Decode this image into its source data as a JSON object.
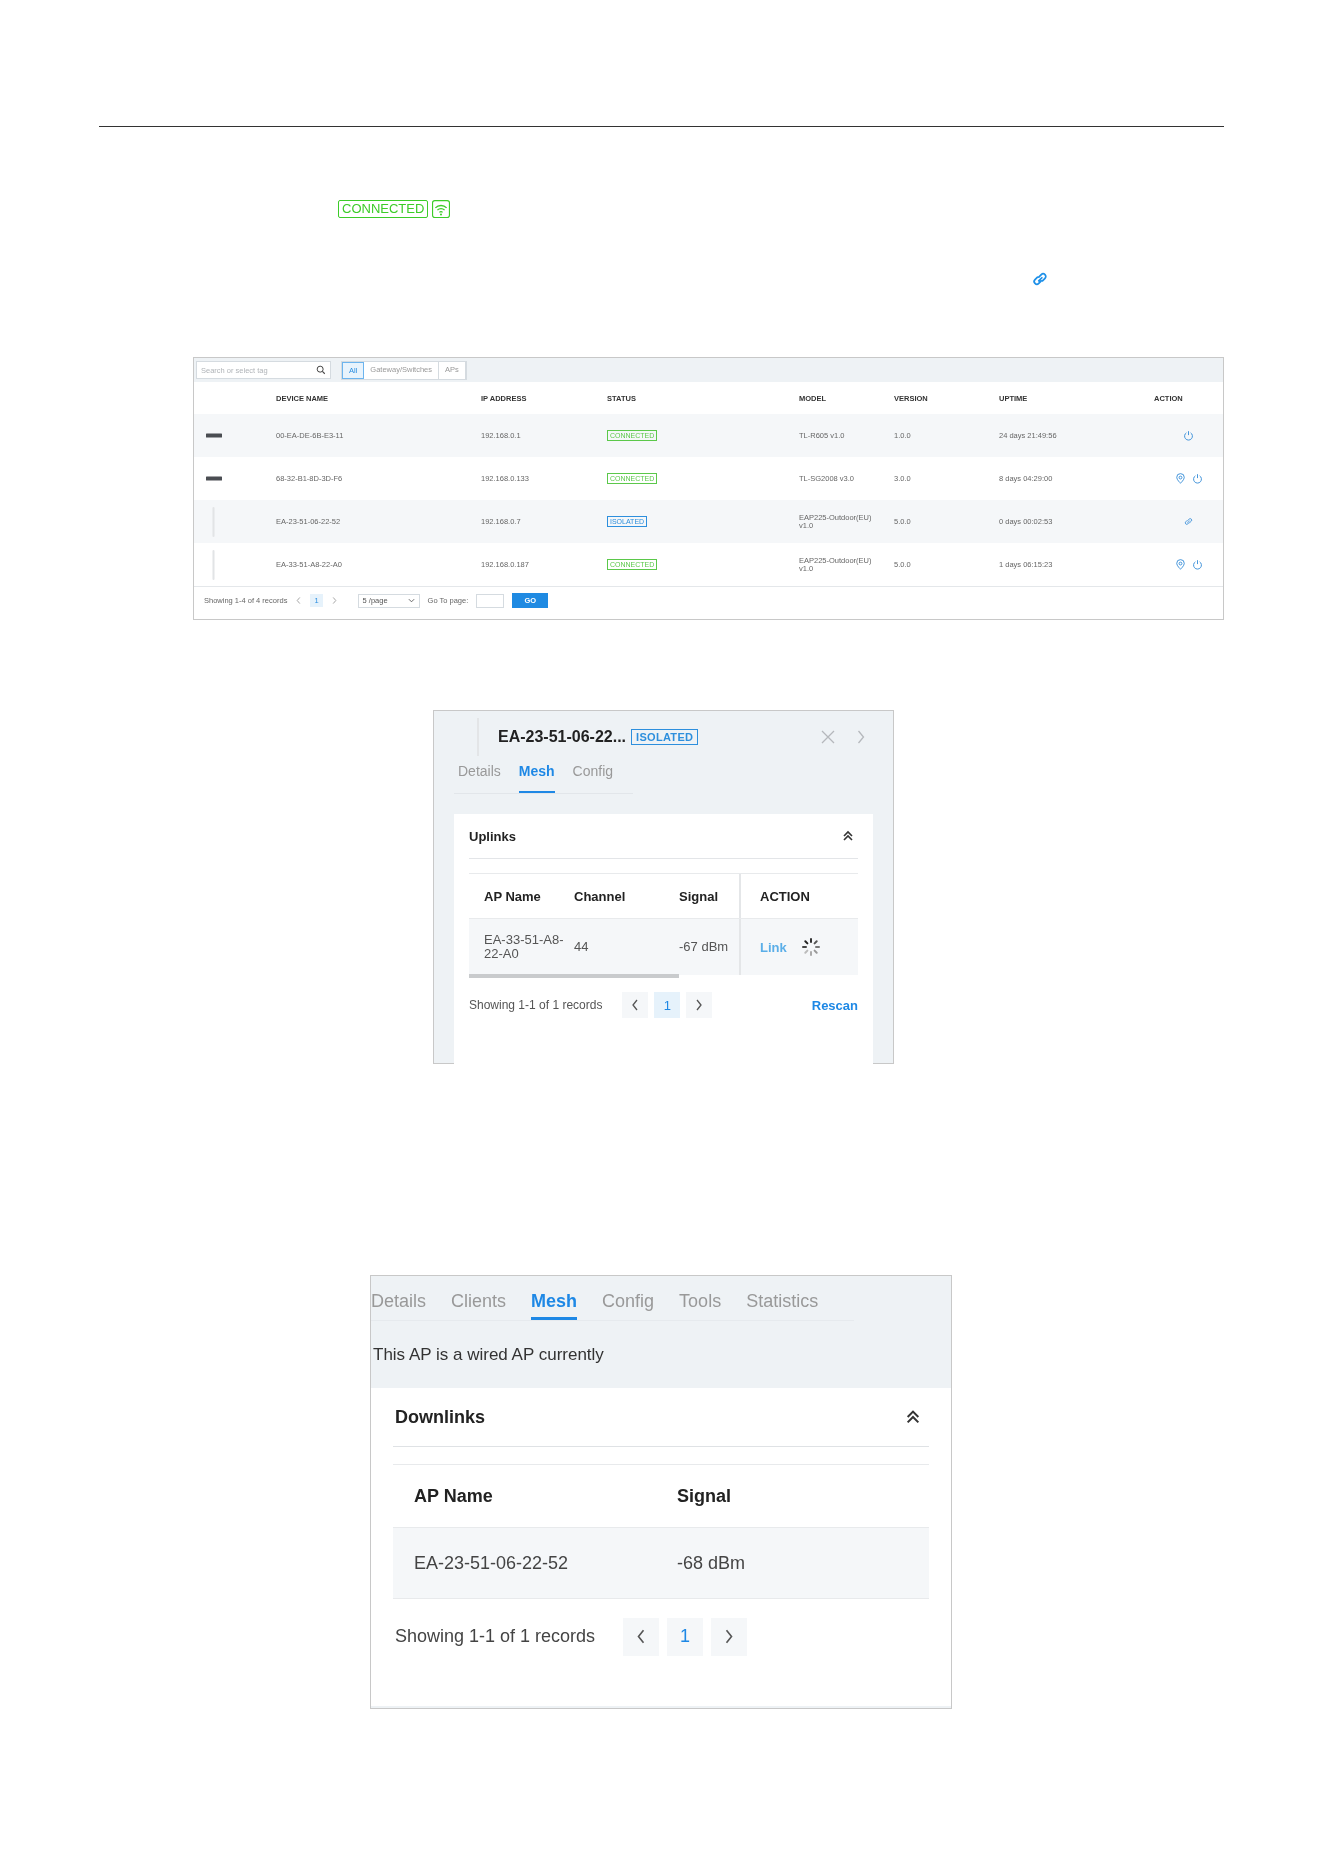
{
  "status_badge": {
    "label": "CONNECTED"
  },
  "device_table": {
    "search": {
      "placeholder": "Search or select tag"
    },
    "filter_tabs": [
      {
        "label": "All",
        "selected": true
      },
      {
        "label": "Gateway/Switches",
        "selected": false
      },
      {
        "label": "APs",
        "selected": false
      }
    ],
    "columns": [
      "DEVICE NAME",
      "IP ADDRESS",
      "STATUS",
      "MODEL",
      "VERSION",
      "UPTIME",
      "ACTION"
    ],
    "rows": [
      {
        "kind": "device",
        "name": "00-EA-DE-6B-E3-11",
        "ip": "192.168.0.1",
        "status": {
          "label": "CONNECTED",
          "kind": "connected"
        },
        "model": "TL-R605 v1.0",
        "version": "1.0.0",
        "uptime": "24 days 21:49:56",
        "actions": [
          {
            "kind": "reboot"
          }
        ]
      },
      {
        "kind": "device",
        "name": "68-32-B1-8D-3D-F6",
        "ip": "192.168.0.133",
        "status": {
          "label": "CONNECTED",
          "kind": "connected"
        },
        "model": "TL-SG2008 v3.0",
        "version": "3.0.0",
        "uptime": "8 days 04:29:00",
        "actions": [
          {
            "kind": "locate"
          },
          {
            "kind": "reboot"
          }
        ]
      },
      {
        "kind": "ap",
        "name": "EA-23-51-06-22-52",
        "ip": "192.168.0.7",
        "status": {
          "label": "ISOLATED",
          "kind": "isolated"
        },
        "model": "EAP225-Outdoor(EU) v1.0",
        "version": "5.0.0",
        "uptime": "0 days 00:02:53",
        "actions": [
          {
            "kind": "link"
          }
        ]
      },
      {
        "kind": "ap",
        "name": "EA-33-51-A8-22-A0",
        "ip": "192.168.0.187",
        "status": {
          "label": "CONNECTED",
          "kind": "connected"
        },
        "model": "EAP225-Outdoor(EU) v1.0",
        "version": "5.0.0",
        "uptime": "1 days 06:15:23",
        "actions": [
          {
            "kind": "locate"
          },
          {
            "kind": "reboot"
          }
        ]
      }
    ],
    "footer": {
      "records": "Showing 1-4 of 4 records",
      "page": "1",
      "per_page": "5 /page",
      "goto_label": "Go To page:",
      "go": "GO"
    }
  },
  "uplinks_panel": {
    "title": "EA-23-51-06-22...",
    "status": {
      "label": "ISOLATED",
      "kind": "isolated"
    },
    "tabs": [
      {
        "label": "Details",
        "selected": false
      },
      {
        "label": "Mesh",
        "selected": true
      },
      {
        "label": "Config",
        "selected": false
      }
    ],
    "section": "Uplinks",
    "columns": [
      "AP Name",
      "Channel",
      "Signal",
      "ACTION"
    ],
    "rows": [
      {
        "ap_name": "EA-33-51-A8-22-A0",
        "channel": "44",
        "signal": "-67 dBm",
        "action": "Link"
      }
    ],
    "footer": {
      "records": "Showing 1-1 of 1 records",
      "page": "1",
      "rescan": "Rescan"
    }
  },
  "downlinks_panel": {
    "tabs": [
      {
        "label": "Details",
        "selected": false
      },
      {
        "label": "Clients",
        "selected": false
      },
      {
        "label": "Mesh",
        "selected": true
      },
      {
        "label": "Config",
        "selected": false
      },
      {
        "label": "Tools",
        "selected": false
      },
      {
        "label": "Statistics",
        "selected": false
      }
    ],
    "notice": "This AP is a wired AP currently",
    "section": "Downlinks",
    "columns": [
      "AP Name",
      "Signal"
    ],
    "rows": [
      {
        "ap_name": "EA-23-51-06-22-52",
        "signal": "-68 dBm"
      }
    ],
    "footer": {
      "records": "Showing 1-1 of 1 records",
      "page": "1"
    }
  }
}
